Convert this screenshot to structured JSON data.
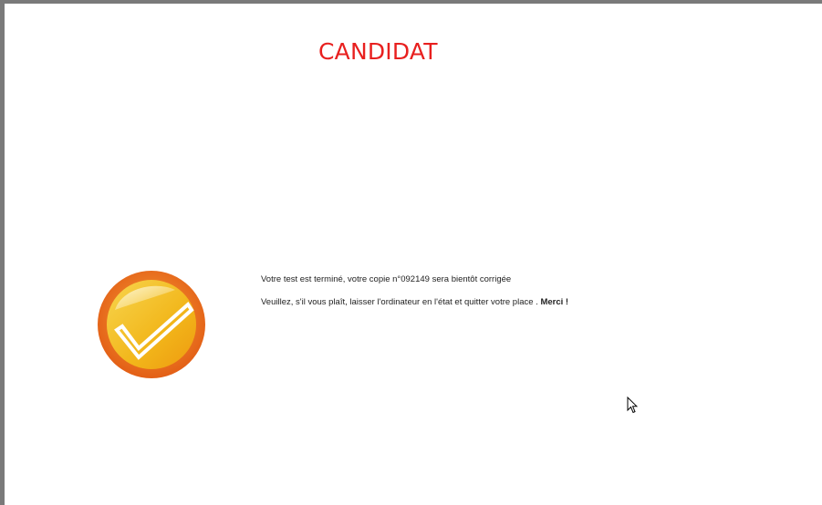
{
  "page": {
    "title": "CANDIDAT"
  },
  "status_icon": {
    "name": "check-badge-icon",
    "colors": {
      "outer": "#e86f1a",
      "inner": "#f4b21b",
      "check": "#ffffff"
    }
  },
  "messages": {
    "line1": "Votre test est terminé, votre copie n°092149 sera bientôt corrigée",
    "line2": "Veuillez, s'il vous plaît, laisser l'ordinateur en l'état et quitter votre place .",
    "thanks": "Merci !"
  },
  "cursor": {
    "icon": "mouse-pointer-icon"
  }
}
